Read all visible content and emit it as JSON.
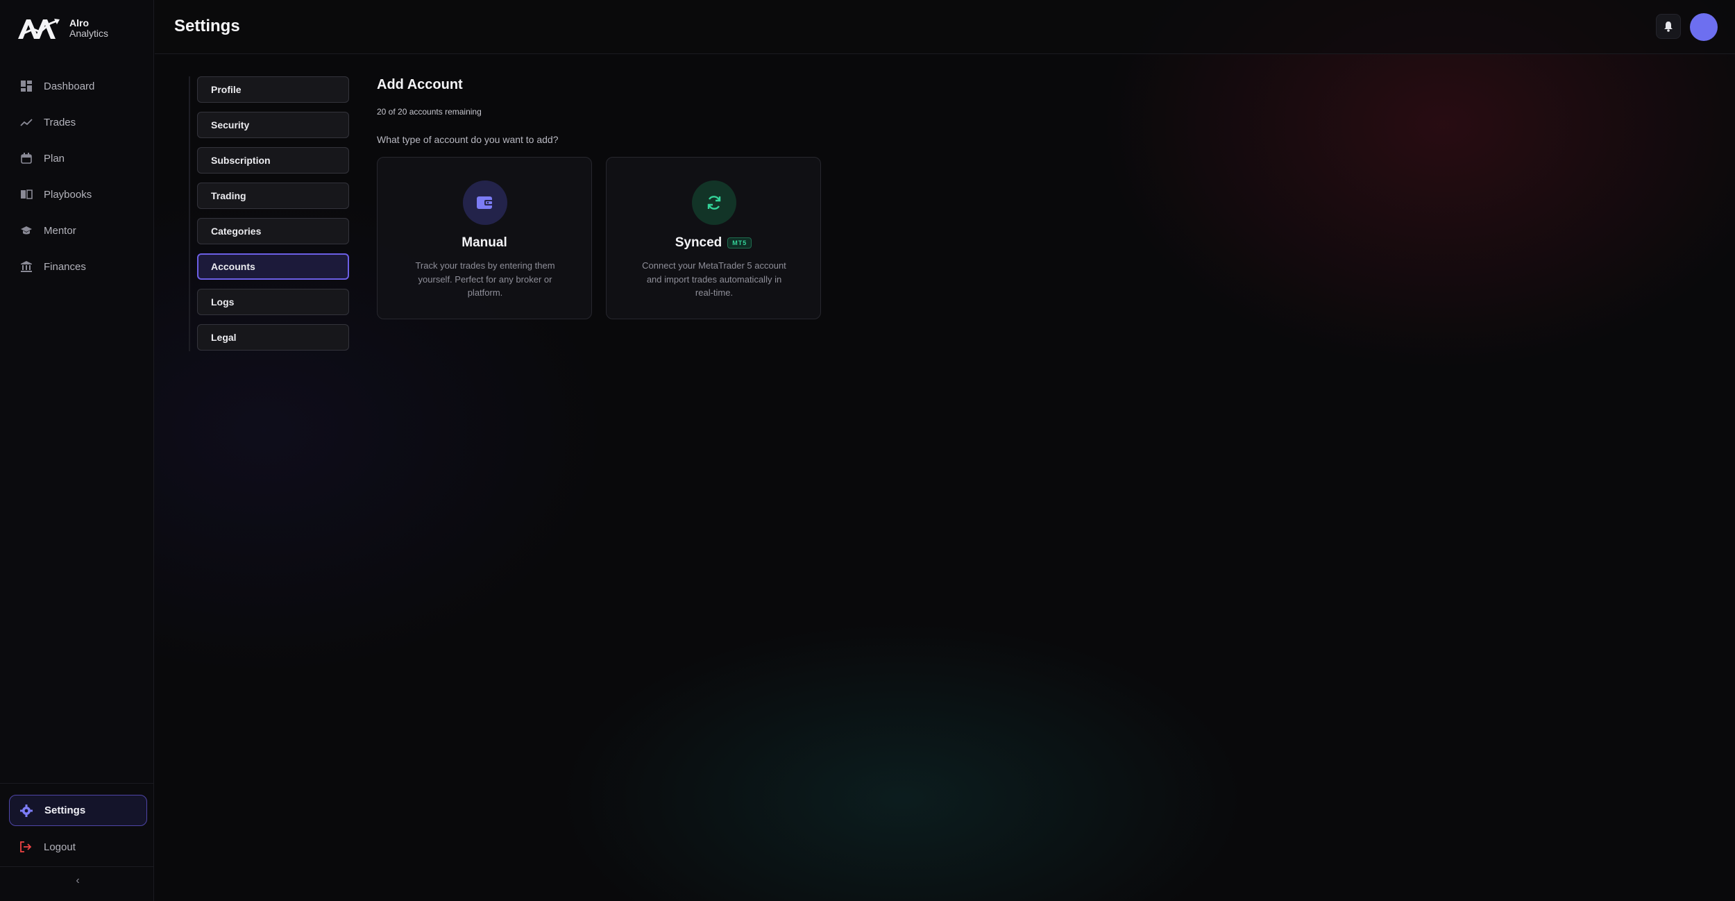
{
  "app": {
    "logo_line1": "Alro",
    "logo_line2": "Analytics"
  },
  "sidebar": {
    "items": [
      {
        "label": "Dashboard",
        "icon": "grid-icon"
      },
      {
        "label": "Trades",
        "icon": "trend-line-icon"
      },
      {
        "label": "Plan",
        "icon": "calendar-icon"
      },
      {
        "label": "Playbooks",
        "icon": "book-icon"
      },
      {
        "label": "Mentor",
        "icon": "graduation-cap-icon"
      },
      {
        "label": "Finances",
        "icon": "bank-icon"
      }
    ],
    "settings_label": "Settings",
    "logout_label": "Logout",
    "collapse_glyph": "‹"
  },
  "header": {
    "title": "Settings"
  },
  "settings_tabs": [
    {
      "label": "Profile",
      "active": false
    },
    {
      "label": "Security",
      "active": false
    },
    {
      "label": "Subscription",
      "active": false
    },
    {
      "label": "Trading",
      "active": false
    },
    {
      "label": "Categories",
      "active": false
    },
    {
      "label": "Accounts",
      "active": true
    },
    {
      "label": "Logs",
      "active": false
    },
    {
      "label": "Legal",
      "active": false
    }
  ],
  "main": {
    "title": "Add Account",
    "remaining": "20 of 20 accounts remaining",
    "question": "What type of account do you want to add?",
    "cards": {
      "manual": {
        "title": "Manual",
        "description": "Track your trades by entering them yourself. Perfect for any broker or platform.",
        "icon": "wallet-icon"
      },
      "synced": {
        "title": "Synced",
        "badge": "MT5",
        "description": "Connect your MetaTrader 5 account and import trades automatically in real-time.",
        "icon": "sync-icon"
      }
    }
  },
  "colors": {
    "accent": "#6c5fe6",
    "avatar": "#6d6ff0",
    "sync_green": "#34d399",
    "logout_red": "#ef4444"
  }
}
